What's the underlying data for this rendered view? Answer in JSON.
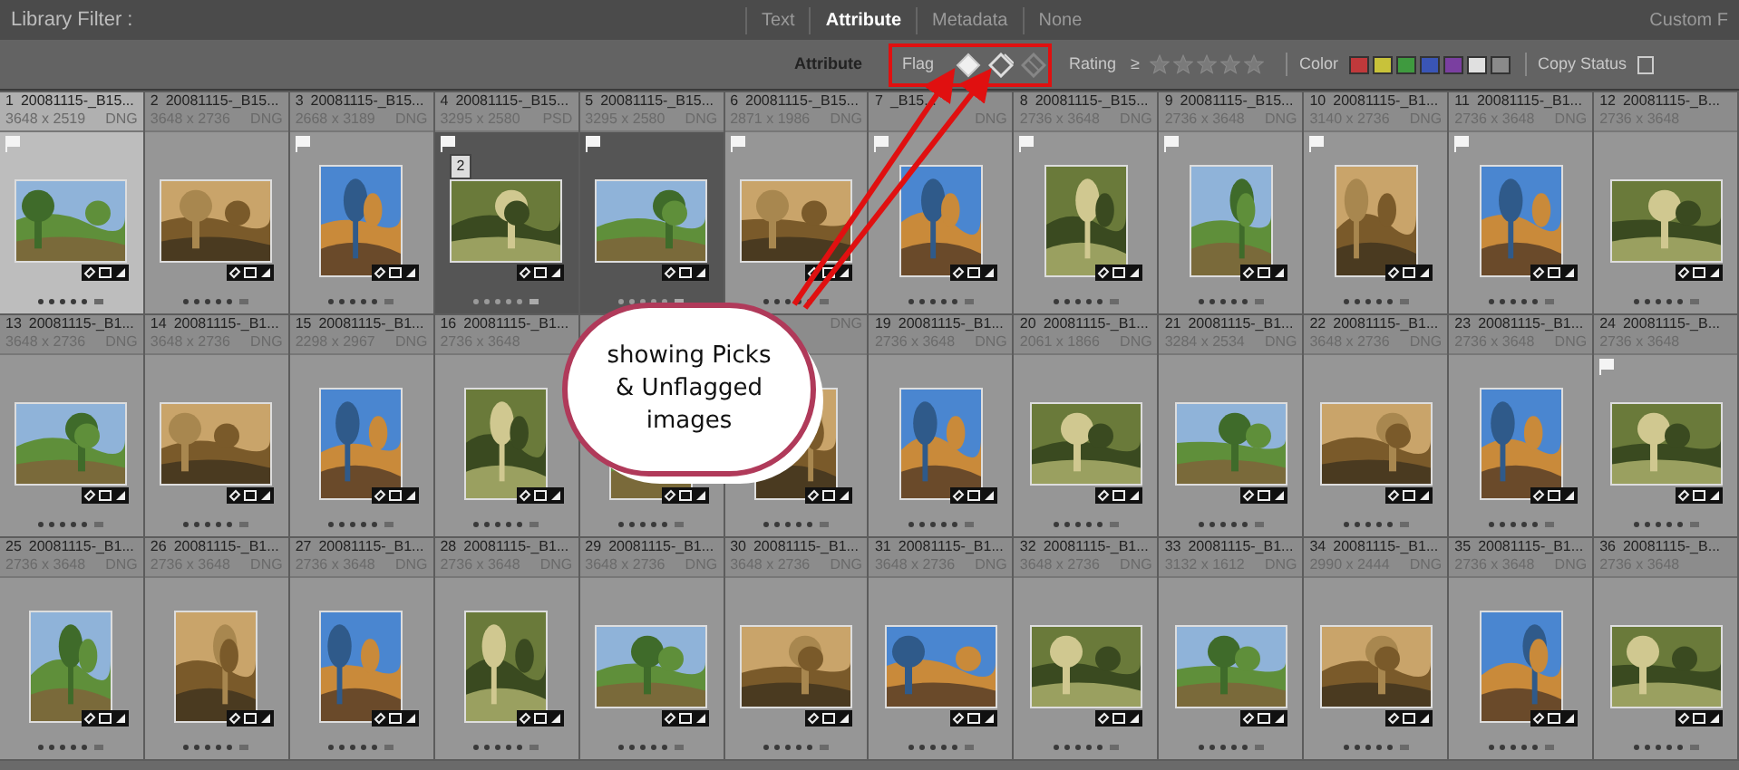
{
  "filter_bar": {
    "title": "Library Filter :",
    "tabs": [
      {
        "label": "Text",
        "selected": false
      },
      {
        "label": "Attribute",
        "selected": true
      },
      {
        "label": "Metadata",
        "selected": false
      },
      {
        "label": "None",
        "selected": false
      }
    ],
    "preset": "Custom F"
  },
  "attribute_bar": {
    "label": "Attribute",
    "flag_label": "Flag",
    "flags": [
      {
        "kind": "pick",
        "selected": true
      },
      {
        "kind": "unflagged",
        "selected": true
      },
      {
        "kind": "rejected",
        "selected": false
      }
    ],
    "rating_label": "Rating",
    "rating_op": "≥",
    "stars": 0,
    "color_label": "Color",
    "swatches": [
      {
        "color": "#c0393b"
      },
      {
        "color": "#c8c23a"
      },
      {
        "color": "#3f9a3f"
      },
      {
        "color": "#3a55b5"
      },
      {
        "color": "#7a3fa0"
      },
      {
        "color": "#e0e0e0"
      },
      {
        "color": "#8a8a8a"
      }
    ],
    "copy_status": "Copy Status"
  },
  "cells": [
    {
      "index": "1",
      "name": "20081115-_B15...",
      "dims": "3648 x 2519",
      "format": "DNG",
      "flag": true,
      "portrait": false,
      "selected": true,
      "stacked": false
    },
    {
      "index": "2",
      "name": "20081115-_B15...",
      "dims": "3648 x 2736",
      "format": "DNG",
      "flag": false,
      "portrait": false,
      "selected": false,
      "stacked": false
    },
    {
      "index": "3",
      "name": "20081115-_B15...",
      "dims": "2668 x 3189",
      "format": "DNG",
      "flag": true,
      "portrait": true,
      "selected": false,
      "stacked": false
    },
    {
      "index": "4",
      "name": "20081115-_B15...",
      "dims": "3295 x 2580",
      "format": "PSD",
      "flag": true,
      "portrait": false,
      "selected": false,
      "stacked": true,
      "stack_count": "2"
    },
    {
      "index": "5",
      "name": "20081115-_B15...",
      "dims": "3295 x 2580",
      "format": "DNG",
      "flag": true,
      "portrait": false,
      "selected": false,
      "stacked": true
    },
    {
      "index": "6",
      "name": "20081115-_B15...",
      "dims": "2871 x 1986",
      "format": "DNG",
      "flag": true,
      "portrait": false,
      "selected": false,
      "stacked": false
    },
    {
      "index": "7",
      "name": "_B15...",
      "format": "DNG",
      "flag": true,
      "portrait": true,
      "selected": false,
      "stacked": false
    },
    {
      "index": "8",
      "name": "20081115-_B15...",
      "dims": "2736 x 3648",
      "format": "DNG",
      "flag": true,
      "portrait": true,
      "selected": false,
      "stacked": false
    },
    {
      "index": "9",
      "name": "20081115-_B15...",
      "dims": "2736 x 3648",
      "format": "DNG",
      "flag": true,
      "portrait": true,
      "selected": false,
      "stacked": false
    },
    {
      "index": "10",
      "name": "20081115-_B1...",
      "dims": "3140 x 2736",
      "format": "DNG",
      "flag": true,
      "portrait": true,
      "selected": false,
      "stacked": false
    },
    {
      "index": "11",
      "name": "20081115-_B1...",
      "dims": "2736 x 3648",
      "format": "DNG",
      "flag": true,
      "portrait": true,
      "selected": false,
      "stacked": false
    },
    {
      "index": "12",
      "name": "20081115-_B...",
      "dims": "2736 x 3648",
      "flag": false,
      "portrait": false,
      "selected": false,
      "stacked": false
    },
    {
      "index": "13",
      "name": "20081115-_B1...",
      "dims": "3648 x 2736",
      "format": "DNG",
      "flag": false,
      "portrait": false,
      "selected": false,
      "stacked": false
    },
    {
      "index": "14",
      "name": "20081115-_B1...",
      "dims": "3648 x 2736",
      "format": "DNG",
      "flag": false,
      "portrait": false,
      "selected": false,
      "stacked": false
    },
    {
      "index": "15",
      "name": "20081115-_B1...",
      "dims": "2298 x 2967",
      "format": "DNG",
      "flag": false,
      "portrait": true,
      "selected": false,
      "stacked": false
    },
    {
      "index": "16",
      "name": "20081115-_B1...",
      "dims": "2736 x 3648",
      "flag": false,
      "portrait": true,
      "selected": false,
      "stacked": false
    },
    {
      "flag": false,
      "portrait": true,
      "selected": false,
      "stacked": false
    },
    {
      "format": "DNG",
      "flag": false,
      "portrait": true,
      "selected": false,
      "stacked": false
    },
    {
      "index": "19",
      "name": "20081115-_B1...",
      "dims": "2736 x 3648",
      "format": "DNG",
      "flag": false,
      "portrait": true,
      "selected": false,
      "stacked": false
    },
    {
      "index": "20",
      "name": "20081115-_B1...",
      "dims": "2061 x 1866",
      "format": "DNG",
      "flag": false,
      "portrait": false,
      "selected": false,
      "stacked": false
    },
    {
      "index": "21",
      "name": "20081115-_B1...",
      "dims": "3284 x 2534",
      "format": "DNG",
      "flag": false,
      "portrait": false,
      "selected": false,
      "stacked": false
    },
    {
      "index": "22",
      "name": "20081115-_B1...",
      "dims": "3648 x 2736",
      "format": "DNG",
      "flag": false,
      "portrait": false,
      "selected": false,
      "stacked": false
    },
    {
      "index": "23",
      "name": "20081115-_B1...",
      "dims": "2736 x 3648",
      "format": "DNG",
      "flag": false,
      "portrait": true,
      "selected": false,
      "stacked": false
    },
    {
      "index": "24",
      "name": "20081115-_B...",
      "dims": "2736 x 3648",
      "flag": true,
      "portrait": false,
      "selected": false,
      "stacked": false
    },
    {
      "index": "25",
      "name": "20081115-_B1...",
      "dims": "2736 x 3648",
      "format": "DNG",
      "flag": false,
      "portrait": true,
      "selected": false,
      "stacked": false
    },
    {
      "index": "26",
      "name": "20081115-_B1...",
      "dims": "2736 x 3648",
      "format": "DNG",
      "flag": false,
      "portrait": true,
      "selected": false,
      "stacked": false
    },
    {
      "index": "27",
      "name": "20081115-_B1...",
      "dims": "2736 x 3648",
      "format": "DNG",
      "flag": false,
      "portrait": true,
      "selected": false,
      "stacked": false
    },
    {
      "index": "28",
      "name": "20081115-_B1...",
      "dims": "2736 x 3648",
      "format": "DNG",
      "flag": false,
      "portrait": true,
      "selected": false,
      "stacked": false
    },
    {
      "index": "29",
      "name": "20081115-_B1...",
      "dims": "3648 x 2736",
      "format": "DNG",
      "flag": false,
      "portrait": false,
      "selected": false,
      "stacked": false
    },
    {
      "index": "30",
      "name": "20081115-_B1...",
      "dims": "3648 x 2736",
      "format": "DNG",
      "flag": false,
      "portrait": false,
      "selected": false,
      "stacked": false
    },
    {
      "index": "31",
      "name": "20081115-_B1...",
      "dims": "3648 x 2736",
      "format": "DNG",
      "flag": false,
      "portrait": false,
      "selected": false,
      "stacked": false
    },
    {
      "index": "32",
      "name": "20081115-_B1...",
      "dims": "3648 x 2736",
      "format": "DNG",
      "flag": false,
      "portrait": false,
      "selected": false,
      "stacked": false
    },
    {
      "index": "33",
      "name": "20081115-_B1...",
      "dims": "3132 x 1612",
      "format": "DNG",
      "flag": false,
      "portrait": false,
      "selected": false,
      "stacked": false
    },
    {
      "index": "34",
      "name": "20081115-_B1...",
      "dims": "2990 x 2444",
      "format": "DNG",
      "flag": false,
      "portrait": false,
      "selected": false,
      "stacked": false
    },
    {
      "index": "35",
      "name": "20081115-_B1...",
      "dims": "2736 x 3648",
      "format": "DNG",
      "flag": false,
      "portrait": true,
      "selected": false,
      "stacked": false
    },
    {
      "index": "36",
      "name": "20081115-_B...",
      "dims": "2736 x 3648",
      "flag": false,
      "portrait": false,
      "selected": false,
      "stacked": false
    }
  ],
  "callout": {
    "text": "showing Picks & Unflagged images"
  }
}
